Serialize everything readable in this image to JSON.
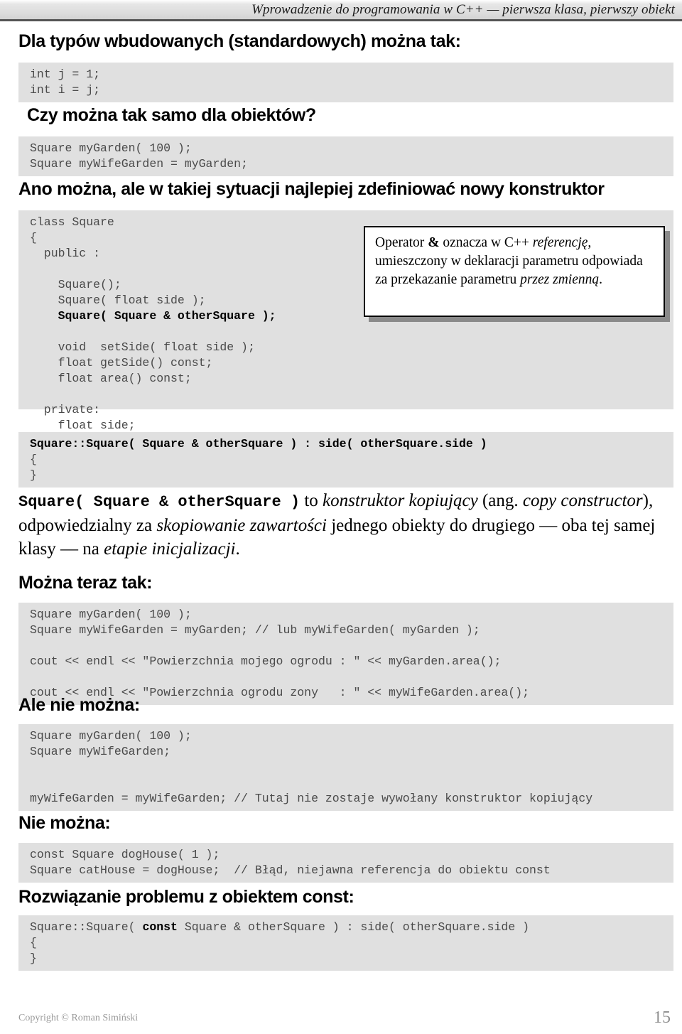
{
  "header": {
    "title": "Wprowadzenie do programowania w C++ — pierwsza klasa, pierwszy obiekt"
  },
  "sections": {
    "builtin_heading": "Dla typów wbudowanych (standardowych) można tak:",
    "builtin_code": "int j = 1;\nint i = j;",
    "objects_question_heading": "Czy można tak samo dla obiektów?",
    "objects_code": "Square myGarden( 100 );\nSquare myWifeGarden = myGarden;",
    "new_constructor_heading": "Ano można, ale w takiej sytuacji najlepiej zdefiniować nowy konstruktor",
    "class_code_pre": "class Square\n{\n  public :\n\n    Square();\n    Square( float side );\n    ",
    "class_code_bold": "Square( Square & otherSquare );",
    "class_code_post": "\n\n    void  setSide( float side );\n    float getSide() const;\n    float area() const;\n\n  private:\n    float side;\n};",
    "ctor_def_code_bold": "Square::Square( Square & otherSquare ) : side( otherSquare.side )",
    "ctor_def_code_rest": "\n{\n}",
    "prose_mono": "Square( Square & otherSquare )",
    "prose_part1": " to ",
    "prose_em1": "konstruktor kopiujący",
    "prose_part2": " (ang. ",
    "prose_em2": "copy constructor",
    "prose_part3": "), odpowiedzialny za ",
    "prose_em3": "skopiowanie zawartości",
    "prose_part4": " jednego obiekty do drugiego — oba tej samej klasy — na ",
    "prose_em4": "etapie inicjalizacji",
    "prose_part5": ".",
    "now_ok_heading": "Można teraz tak:",
    "now_ok_code": "Square myGarden( 100 );\nSquare myWifeGarden = myGarden; // lub myWifeGarden( myGarden );\n\ncout << endl << \"Powierzchnia mojego ogrodu : \" << myGarden.area();\n\ncout << endl << \"Powierzchnia ogrodu zony   : \" << myWifeGarden.area();",
    "but_not_heading": "Ale nie można:",
    "but_not_code": "Square myGarden( 100 );\nSquare myWifeGarden;\n\n\nmyWifeGarden = myWifeGarden; // Tutaj nie zostaje wywołany konstruktor kopiujący",
    "cannot_heading": "Nie można:",
    "cannot_code": "const Square dogHouse( 1 );\nSquare catHouse = dogHouse;  // Błąd, niejawna referencja do obiektu const",
    "solution_heading": "Rozwiązanie problemu z obiektem const:",
    "solution_code_pre": "Square::Square( ",
    "solution_code_bold": "const",
    "solution_code_post": " Square & otherSquare ) : side( otherSquare.side )\n{\n}"
  },
  "callout": {
    "line1_pre": "Operator ",
    "line1_amp": "&",
    "line1_mid": " oznacza w C++ ",
    "line1_em": "referencję",
    "line1_post": ",",
    "line2": "umieszczony w deklaracji parametru",
    "line3": "odpowiada za przekazanie parametru",
    "line4_em": "przez zmienną",
    "line4_post": "."
  },
  "footer": {
    "copyright": "Copyright © Roman Simiński",
    "page_number": "15"
  },
  "colors": {
    "code_background": "#e0e0e0",
    "code_text": "#4a4a4a",
    "header_rule": "#555555",
    "callout_shadow": "#8a8a8a",
    "footer_text": "#9a9a9a"
  }
}
